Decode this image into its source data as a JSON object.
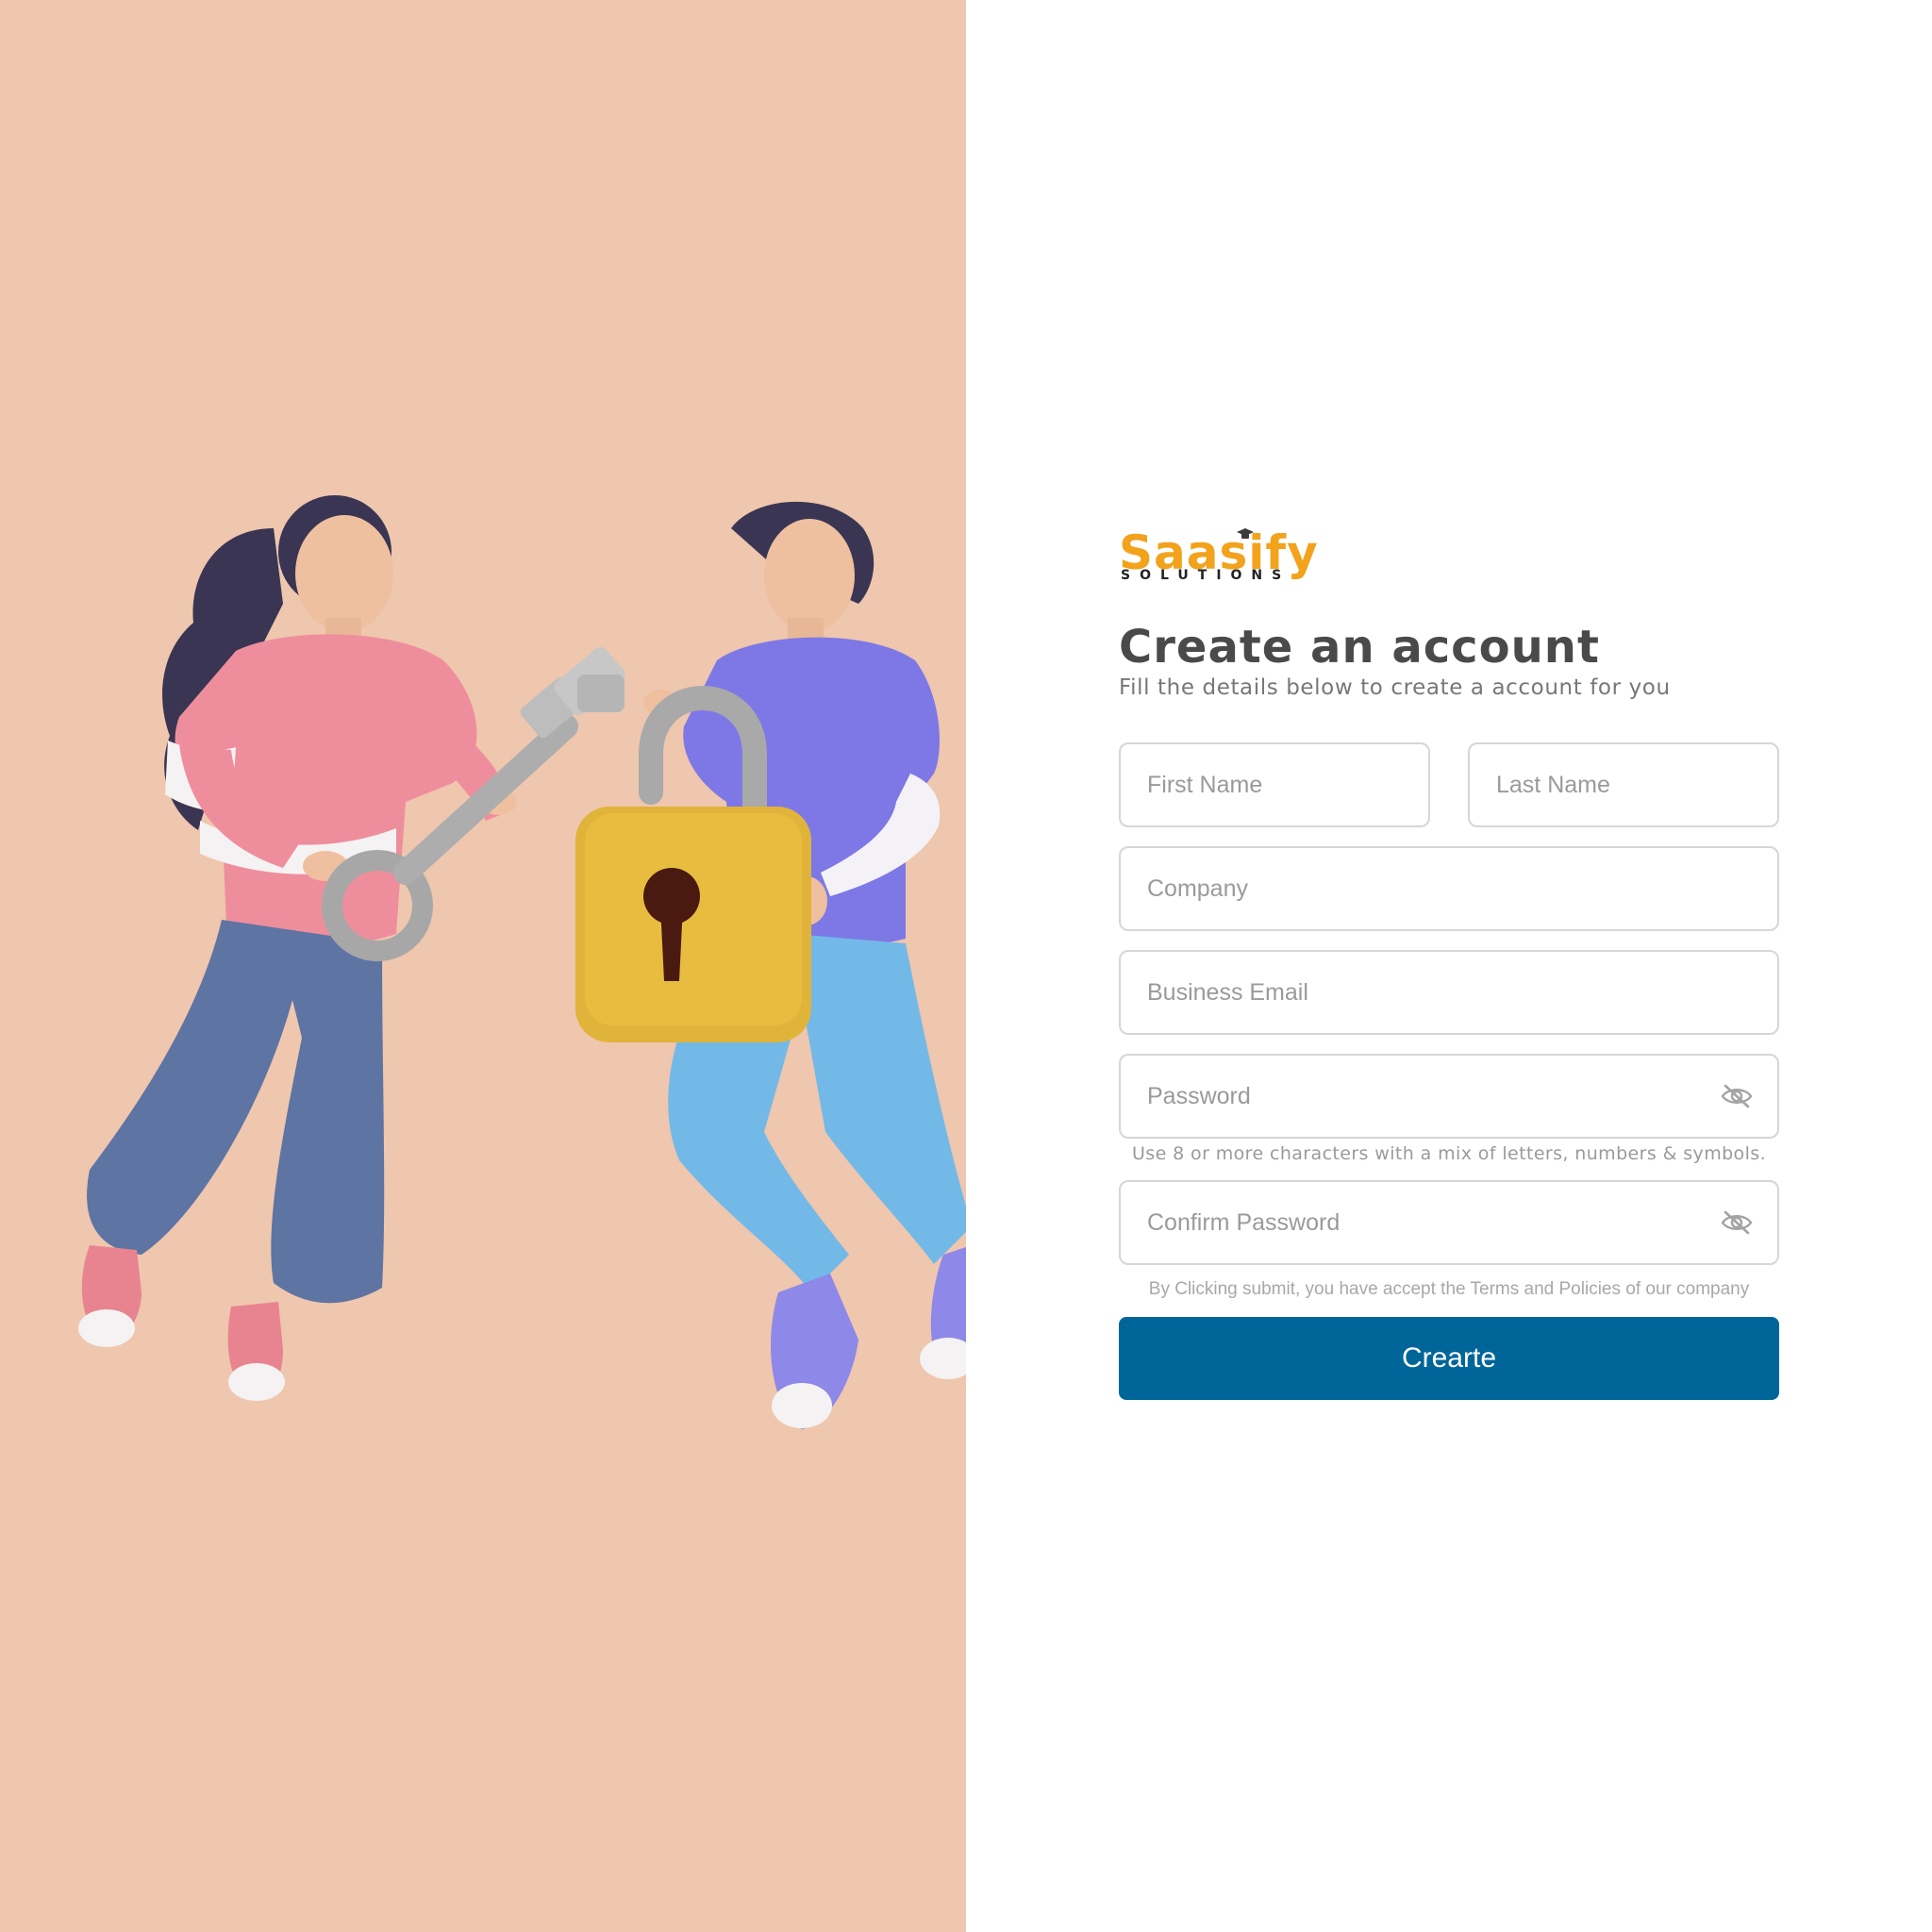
{
  "brand": {
    "name": "Saasify",
    "tagline": "SOLUTIONS"
  },
  "header": {
    "title": "Create an account",
    "subtitle": "Fill the details below to create a account for you"
  },
  "form": {
    "first_name": {
      "placeholder": "First Name",
      "value": ""
    },
    "last_name": {
      "placeholder": "Last Name",
      "value": ""
    },
    "company": {
      "placeholder": "Company",
      "value": ""
    },
    "business_email": {
      "placeholder": "Business Email",
      "value": ""
    },
    "password": {
      "placeholder": "Password",
      "value": "",
      "hint": "Use 8 or more characters with a mix of letters, numbers & symbols."
    },
    "confirm_password": {
      "placeholder": "Confirm Password",
      "value": ""
    },
    "terms_text": "By Clicking submit, you have accept the Terms and Policies of our company",
    "submit_label": "Crearte"
  },
  "icons": {
    "password_toggle": "eye-off-icon"
  },
  "colors": {
    "left_panel": "#EFC6AE",
    "brand": "#F2A21B",
    "button": "#006699"
  }
}
